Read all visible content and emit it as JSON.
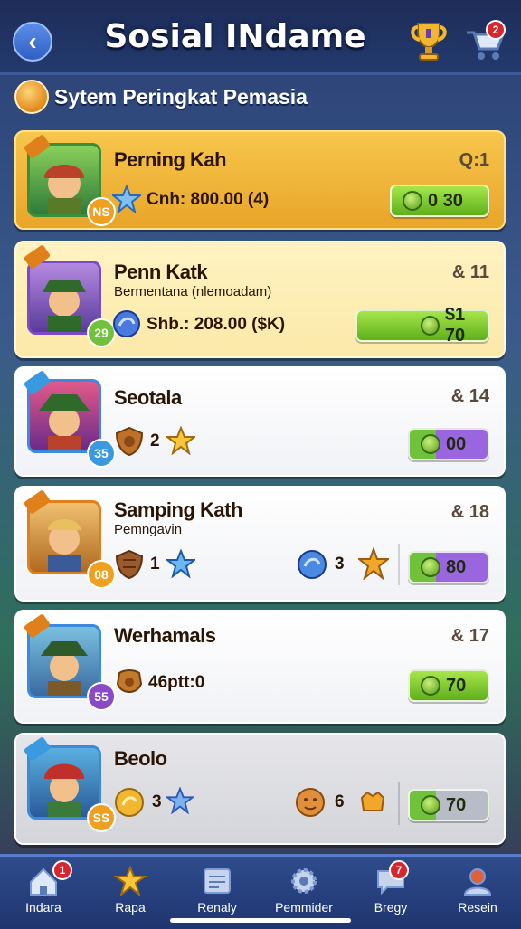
{
  "header": {
    "back_icon": "chevron-left-icon",
    "title": "Sosial INdame",
    "trophy_icon": "trophy-icon",
    "cart_icon": "shopping-cart-icon",
    "cart_badge": "2"
  },
  "subheader": {
    "emblem_icon": "laurel-emblem-icon",
    "title": "Sytem Peringkat Pemasia"
  },
  "cards": [
    {
      "name": "Perning Kah",
      "rank": "Q:1",
      "level": "NS",
      "stat_text": "Cnh: 800.00 (4)",
      "pill_value": "0 30"
    },
    {
      "name": "Penn Katk",
      "subtitle": "Bermentana (nlemoadam)",
      "rank": "& 11",
      "level": "29",
      "stat_text": "Shb.: 208.00 ($K)",
      "pill_value": "$1 70"
    },
    {
      "name": "Seotala",
      "rank": "& 14",
      "level": "35",
      "stat_count": "2",
      "pill_value": "00"
    },
    {
      "name": "Samping Kath",
      "subtitle": "Pemngavin",
      "rank": "& 18",
      "level": "08",
      "stat_count_1": "1",
      "stat_count_2": "3",
      "pill_value": "80"
    },
    {
      "name": "Werhamals",
      "rank": "& 17",
      "level": "55",
      "stat_text": "46ptt:0",
      "pill_value": "70"
    },
    {
      "name": "Beolo",
      "rank": "",
      "level": "SS",
      "stat_count_1": "3",
      "stat_count_2": "6",
      "pill_value": "70"
    }
  ],
  "nav": [
    {
      "label": "Indara",
      "icon": "home-icon",
      "badge": "1"
    },
    {
      "label": "Rapa",
      "icon": "star-icon"
    },
    {
      "label": "Renaly",
      "icon": "news-icon"
    },
    {
      "label": "Pemmider",
      "icon": "settings-gear-icon"
    },
    {
      "label": "Bregy",
      "icon": "chat-icon",
      "badge": "7"
    },
    {
      "label": "Resein",
      "icon": "profile-icon"
    }
  ],
  "colors": {
    "gold_card": "#f7c64c",
    "green_pill": "#7cc832",
    "purple_pill": "#9a66e0",
    "nav_bg": "#2f4c8c",
    "badge_red": "#d8262c"
  }
}
